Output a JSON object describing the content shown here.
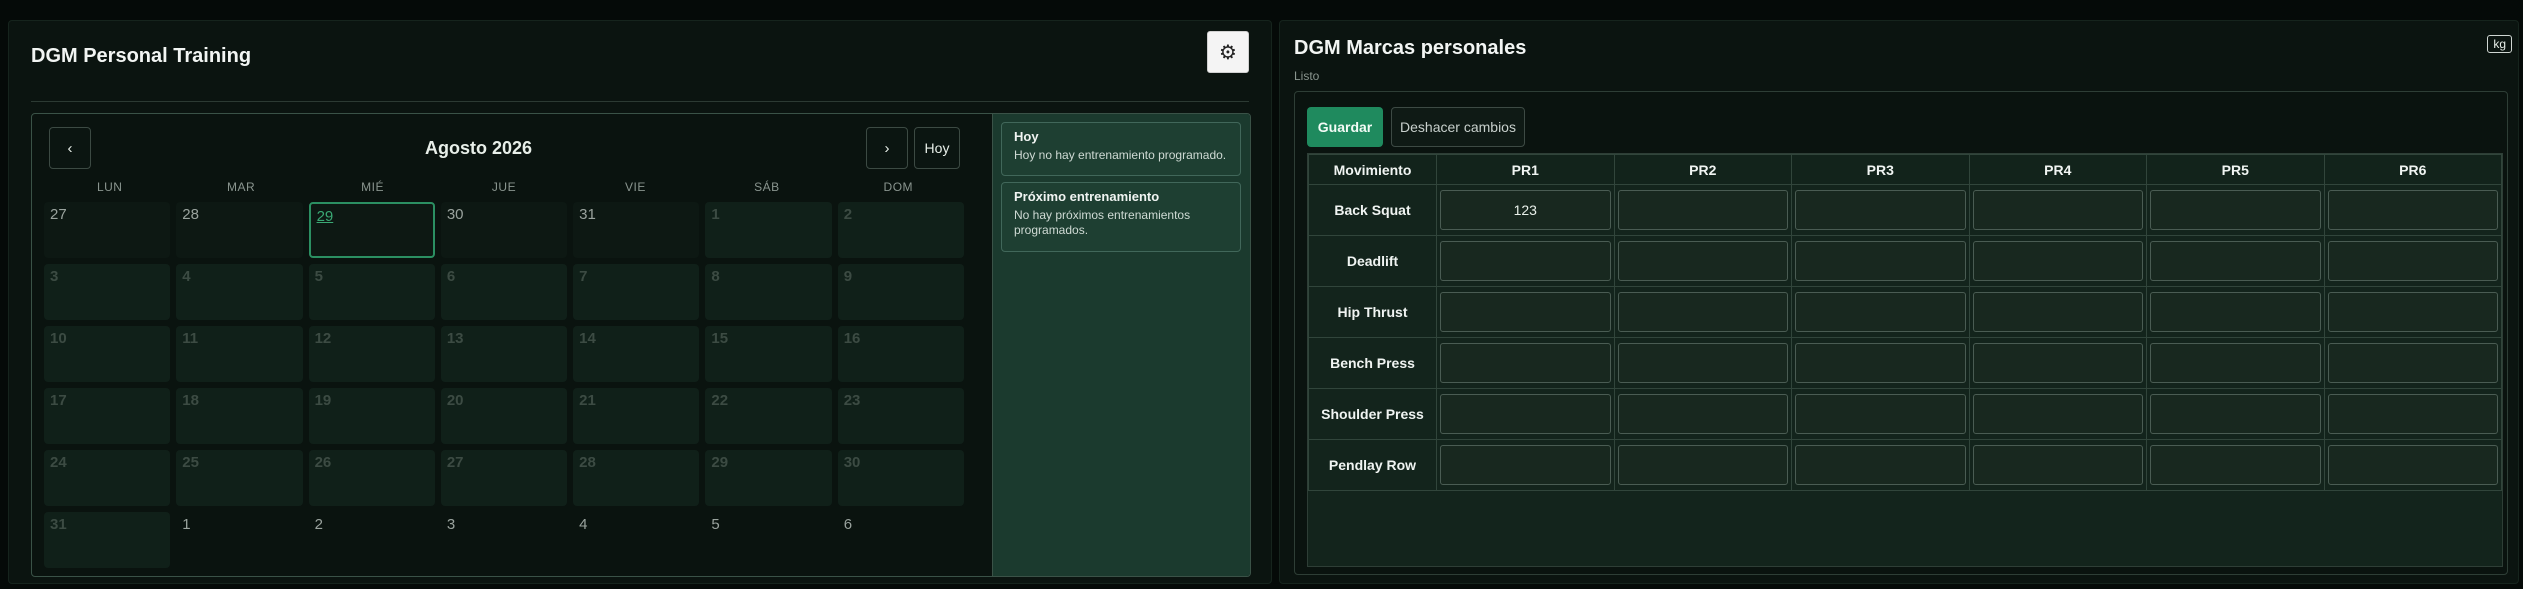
{
  "training": {
    "title": "DGM Personal Training",
    "settings_icon": "⚙",
    "calendar": {
      "prev_label": "‹",
      "next_label": "›",
      "today_label": "Hoy",
      "month_title": "Agosto 2026",
      "weekdays": [
        "LUN",
        "MAR",
        "MIÉ",
        "JUE",
        "VIE",
        "SÁB",
        "DOM"
      ],
      "days": [
        "27",
        "28",
        "29",
        "30",
        "31",
        "1",
        "2",
        "3",
        "4",
        "5",
        "6",
        "7",
        "8",
        "9",
        "10",
        "11",
        "12",
        "13",
        "14",
        "15",
        "16",
        "17",
        "18",
        "19",
        "20",
        "21",
        "22",
        "23",
        "24",
        "25",
        "26",
        "27",
        "28",
        "29",
        "30",
        "31",
        "1",
        "2",
        "3",
        "4",
        "5",
        "6"
      ]
    },
    "today_card": {
      "title": "Hoy",
      "text": "Hoy no hay entrenamiento programado."
    },
    "next_card": {
      "title": "Próximo entrenamiento",
      "text": "No hay próximos entrenamientos programados."
    }
  },
  "records": {
    "title": "DGM Marcas personales",
    "status": "Listo",
    "unit": "kg",
    "save_label": "Guardar",
    "undo_label": "Deshacer cambios",
    "headers": [
      "Movimiento",
      "PR1",
      "PR2",
      "PR3",
      "PR4",
      "PR5",
      "PR6"
    ],
    "rows": [
      {
        "movement": "Back Squat",
        "values": [
          "123",
          "",
          "",
          "",
          "",
          ""
        ]
      },
      {
        "movement": "Deadlift",
        "values": [
          "",
          "",
          "",
          "",
          "",
          ""
        ]
      },
      {
        "movement": "Hip Thrust",
        "values": [
          "",
          "",
          "",
          "",
          "",
          ""
        ]
      },
      {
        "movement": "Bench Press",
        "values": [
          "",
          "",
          "",
          "",
          "",
          ""
        ]
      },
      {
        "movement": "Shoulder Press",
        "values": [
          "",
          "",
          "",
          "",
          "",
          ""
        ]
      },
      {
        "movement": "Pendlay Row",
        "values": [
          "",
          "",
          "",
          "",
          "",
          ""
        ]
      }
    ]
  },
  "colors": {
    "accent": "#1f8a5e",
    "today_outline": "#2b8f62",
    "panel_bg": "#0b1410",
    "sidebar_bg": "#1b3a2e"
  }
}
